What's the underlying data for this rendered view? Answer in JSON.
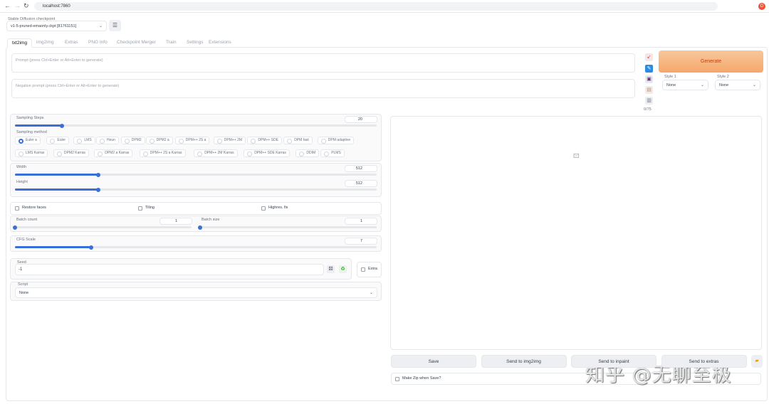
{
  "browser": {
    "url": "localhost:7860",
    "avatar": "O"
  },
  "checkpoint": {
    "label": "Stable Diffusion checkpoint",
    "value": "v1-5-pruned-emaonly.ckpt [81761151]"
  },
  "tabs": [
    "txt2img",
    "img2img",
    "Extras",
    "PNG Info",
    "Checkpoint Merger",
    "Train",
    "Settings",
    "Extensions"
  ],
  "prompt": {
    "placeholder": "Prompt (press Ctrl+Enter or Alt+Enter to generate)",
    "negative_placeholder": "Negative prompt (press Ctrl+Enter or Alt+Enter to generate)",
    "token_count": "0/75"
  },
  "generate": {
    "label": "Generate",
    "color": "#f5a76b"
  },
  "styles": [
    {
      "label": "Style 1",
      "value": "None"
    },
    {
      "label": "Style 2",
      "value": "None"
    }
  ],
  "sampling_steps": {
    "label": "Sampling Steps",
    "value": "20",
    "fraction": 0.13
  },
  "sampling_method": {
    "label": "Sampling method",
    "selected": "Euler a",
    "row1": [
      "Euler a",
      "Euler",
      "LMS",
      "Heun",
      "DPM2",
      "DPM2 a",
      "DPM++ 2S a",
      "DPM++ 2M",
      "DPM++ SDE",
      "DPM fast",
      "DPM adaptive"
    ],
    "row2": [
      "LMS Karras",
      "DPM2 Karras",
      "DPM2 a Karras",
      "DPM++ 2S a Karras",
      "DPM++ 2M Karras",
      "DPM++ SDE Karras",
      "DDIM",
      "PLMS"
    ]
  },
  "width": {
    "label": "Width",
    "value": "512",
    "fraction": 0.23
  },
  "height": {
    "label": "Height",
    "value": "512",
    "fraction": 0.23
  },
  "options": {
    "restore_faces": "Restore faces",
    "tiling": "Tiling",
    "hires": "Highres. fix"
  },
  "batch_count": {
    "label": "Batch count",
    "value": "1",
    "fraction": 0
  },
  "batch_size": {
    "label": "Batch size",
    "value": "1",
    "fraction": 0
  },
  "cfg": {
    "label": "CFG Scale",
    "value": "7",
    "fraction": 0.21
  },
  "seed": {
    "label": "Seed",
    "value": "-1",
    "extra": "Extra"
  },
  "script": {
    "label": "Script",
    "value": "None"
  },
  "output": {
    "buttons": [
      "Save",
      "Send to img2img",
      "Send to inpaint",
      "Send to extras"
    ],
    "make_zip": "Make Zip when Save?"
  },
  "watermark": "知乎 @无聊至极"
}
